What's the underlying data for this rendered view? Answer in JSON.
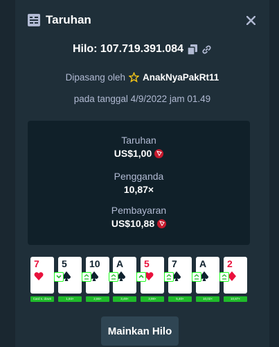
{
  "modal": {
    "title": "Taruhan",
    "header_icon": "bet-slip-icon",
    "close_icon": "close-icon"
  },
  "bet": {
    "game": "Hilo",
    "id": "107.719.391.084",
    "label": "Hilo: 107.719.391.084",
    "placed_by_prefix": "Dipasang oleh",
    "username": "AnakNyaPakRt11",
    "date_text": "pada tanggal 4/9/2022 jam 01.49",
    "copy_icon": "copy-icon",
    "link_icon": "link-icon",
    "user_icon": "star-icon"
  },
  "stats": {
    "wager_label": "Taruhan",
    "wager_value": "US$1,00",
    "multiplier_label": "Pengganda",
    "multiplier_value": "10,87×",
    "payout_label": "Pembayaran",
    "payout_value": "US$10,88",
    "currency_icon": "tron-coin-icon",
    "payout_color": "#1fff20"
  },
  "cards": [
    {
      "rank": "7",
      "suit": "hearts",
      "color": "red",
      "badge": "",
      "multiplier": "Card s. down"
    },
    {
      "rank": "5",
      "suit": "spades",
      "color": "black",
      "badge": "lower",
      "multiplier": "1,84×"
    },
    {
      "rank": "10",
      "suit": "spades",
      "color": "black",
      "badge": "equal",
      "multiplier": "2,66×"
    },
    {
      "rank": "A",
      "suit": "spades",
      "color": "black",
      "badge": "equal",
      "multiplier": "3,49×"
    },
    {
      "rank": "5",
      "suit": "hearts",
      "color": "red",
      "badge": "higher",
      "multiplier": "3,98×"
    },
    {
      "rank": "7",
      "suit": "spades",
      "color": "black",
      "badge": "equal",
      "multiplier": "5,40×"
    },
    {
      "rank": "A",
      "suit": "spades",
      "color": "black",
      "badge": "equal",
      "multiplier": "10,02×"
    },
    {
      "rank": "2",
      "suit": "diamonds",
      "color": "red",
      "badge": "equal",
      "multiplier": "10,87×"
    }
  ],
  "play_button": "Mainkan Hilo"
}
